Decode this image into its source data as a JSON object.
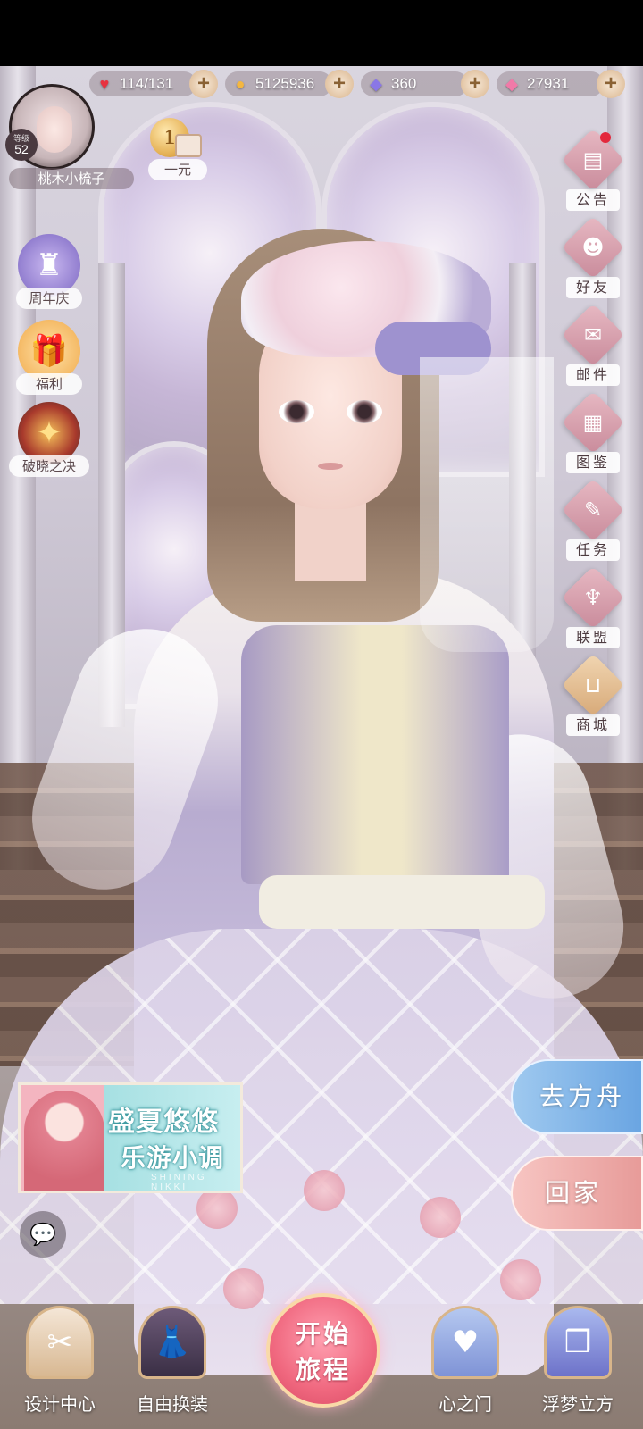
{
  "resources": {
    "stamina": {
      "value": "114/131",
      "icon": "heart-icon",
      "color": "#e8323f"
    },
    "gold": {
      "value": "5125936",
      "icon": "cat-coin-icon",
      "color": "#f4b740"
    },
    "diamond": {
      "value": "360",
      "icon": "diamond-icon",
      "color": "#8a77e6"
    },
    "crystal": {
      "value": "27931",
      "icon": "pink-crystal-icon",
      "color": "#f17aa8"
    },
    "add_symbol": "+"
  },
  "player": {
    "name": "桃木小梳子",
    "level_prefix": "等级",
    "level": "52"
  },
  "promo": {
    "coin_text": "1",
    "label": "一元"
  },
  "left_menu": [
    {
      "label": "周年庆",
      "icon": "castle-icon"
    },
    {
      "label": "福利",
      "icon": "gift-box-icon"
    },
    {
      "label": "破晓之决",
      "icon": "compass-star-icon"
    }
  ],
  "right_menu": [
    {
      "label": "公告",
      "icon": "notice-board-icon",
      "has_dot": true
    },
    {
      "label": "好友",
      "icon": "friend-icon"
    },
    {
      "label": "邮件",
      "icon": "mail-icon"
    },
    {
      "label": "图鉴",
      "icon": "card-collection-icon"
    },
    {
      "label": "任务",
      "icon": "task-icon"
    },
    {
      "label": "联盟",
      "icon": "alliance-wings-icon"
    },
    {
      "label": "商城",
      "icon": "shopping-bag-icon"
    }
  ],
  "banner": {
    "line1": "盛夏悠悠",
    "line2": "乐游小调",
    "deco": "SHINING NIKKI"
  },
  "actions": {
    "go_ark": "去方舟",
    "go_home": "回家"
  },
  "start": {
    "line1": "开始",
    "line2": "旅程"
  },
  "bottom_nav": [
    {
      "label": "设计中心",
      "icon": "sewing-machine-icon"
    },
    {
      "label": "自由换装",
      "icon": "dress-icon"
    },
    {
      "label": "心之门",
      "icon": "heart-door-icon"
    },
    {
      "label": "浮梦立方",
      "icon": "cube-icon"
    }
  ]
}
